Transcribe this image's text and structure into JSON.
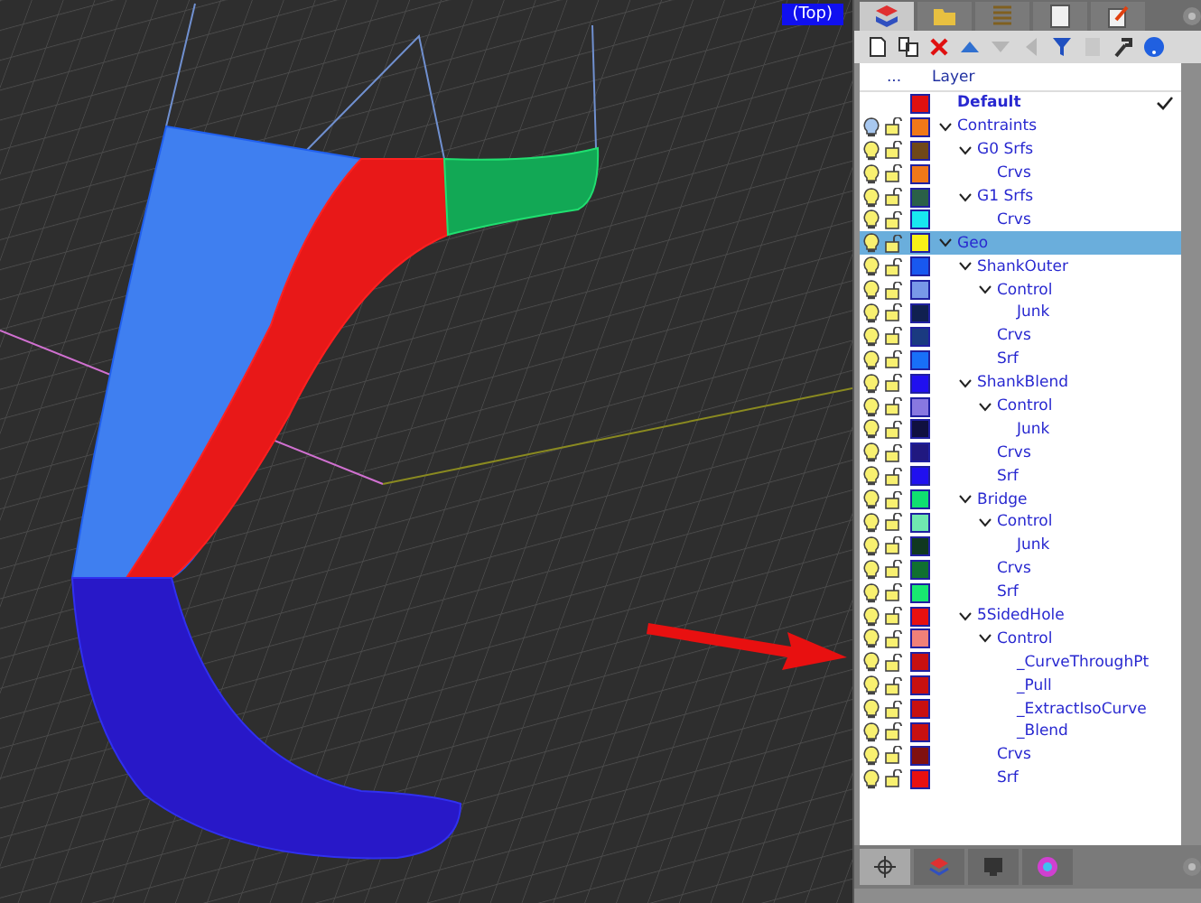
{
  "viewport": {
    "label": "(Top)"
  },
  "panel_tabs": [
    {
      "kind": "layers",
      "selected": true
    },
    {
      "kind": "folder",
      "selected": false
    },
    {
      "kind": "list",
      "selected": false
    },
    {
      "kind": "notes",
      "selected": false
    },
    {
      "kind": "edit",
      "selected": false
    }
  ],
  "toolbar": [
    {
      "kind": "new",
      "disabled": false
    },
    {
      "kind": "copy",
      "disabled": false
    },
    {
      "kind": "delete",
      "disabled": false
    },
    {
      "kind": "up",
      "disabled": false
    },
    {
      "kind": "down",
      "disabled": true
    },
    {
      "kind": "left",
      "disabled": true
    },
    {
      "kind": "filter",
      "disabled": false
    },
    {
      "kind": "page",
      "disabled": true
    },
    {
      "kind": "tools",
      "disabled": false
    },
    {
      "kind": "help",
      "disabled": false
    }
  ],
  "table": {
    "columns": [
      "...",
      "Layer"
    ],
    "layers": [
      {
        "name": "Default",
        "color": "#e01010",
        "current": true,
        "selected": false
      },
      {
        "name": "Contraints",
        "color": "#f07818",
        "current": false,
        "selected": false,
        "expanded": true,
        "children": [
          {
            "name": "G0 Srfs",
            "color": "#704818",
            "current": false,
            "selected": false,
            "expanded": true,
            "children": [
              {
                "name": "Crvs",
                "color": "#f07818",
                "current": false,
                "selected": false
              }
            ]
          },
          {
            "name": "G1 Srfs",
            "color": "#2a6048",
            "current": false,
            "selected": false,
            "expanded": true,
            "children": [
              {
                "name": "Crvs",
                "color": "#18e8f0",
                "current": false,
                "selected": false
              }
            ]
          }
        ]
      },
      {
        "name": "Geo",
        "color": "#f8f018",
        "current": false,
        "selected": true,
        "expanded": true,
        "children": [
          {
            "name": "ShankOuter",
            "color": "#1858f0",
            "current": false,
            "selected": false,
            "expanded": true,
            "children": [
              {
                "name": "Control",
                "color": "#7898e8",
                "current": false,
                "selected": false,
                "expanded": true,
                "children": [
                  {
                    "name": "Junk",
                    "color": "#102050",
                    "current": false,
                    "selected": false
                  }
                ]
              },
              {
                "name": "Crvs",
                "color": "#1a3a80",
                "current": false,
                "selected": false
              },
              {
                "name": "Srf",
                "color": "#1870f8",
                "current": false,
                "selected": false
              }
            ]
          },
          {
            "name": "ShankBlend",
            "color": "#2010f0",
            "current": false,
            "selected": false,
            "expanded": true,
            "children": [
              {
                "name": "Control",
                "color": "#8878e0",
                "current": false,
                "selected": false,
                "expanded": true,
                "children": [
                  {
                    "name": "Junk",
                    "color": "#101040",
                    "current": false,
                    "selected": false
                  }
                ]
              },
              {
                "name": "Crvs",
                "color": "#201880",
                "current": false,
                "selected": false
              },
              {
                "name": "Srf",
                "color": "#2010f0",
                "current": false,
                "selected": false
              }
            ]
          },
          {
            "name": "Bridge",
            "color": "#10e070",
            "current": false,
            "selected": false,
            "expanded": true,
            "children": [
              {
                "name": "Control",
                "color": "#70e8b0",
                "current": false,
                "selected": false,
                "expanded": true,
                "children": [
                  {
                    "name": "Junk",
                    "color": "#103820",
                    "current": false,
                    "selected": false
                  }
                ]
              },
              {
                "name": "Crvs",
                "color": "#107030",
                "current": false,
                "selected": false
              },
              {
                "name": "Srf",
                "color": "#18e870",
                "current": false,
                "selected": false
              }
            ]
          },
          {
            "name": "5SidedHole",
            "color": "#e81010",
            "current": false,
            "selected": false,
            "expanded": true,
            "children": [
              {
                "name": "Control",
                "color": "#f08078",
                "current": false,
                "selected": false,
                "expanded": true,
                "children": [
                  {
                    "name": "_CurveThroughPt",
                    "color": "#c81010",
                    "current": false,
                    "selected": false
                  },
                  {
                    "name": "_Pull",
                    "color": "#c81010",
                    "current": false,
                    "selected": false
                  },
                  {
                    "name": "_ExtractIsoCurve",
                    "color": "#c81010",
                    "current": false,
                    "selected": false
                  },
                  {
                    "name": "_Blend",
                    "color": "#c81010",
                    "current": false,
                    "selected": false
                  }
                ]
              },
              {
                "name": "Crvs",
                "color": "#801010",
                "current": false,
                "selected": false
              },
              {
                "name": "Srf",
                "color": "#e81010",
                "current": false,
                "selected": false
              }
            ]
          }
        ]
      }
    ]
  },
  "bottom_tabs": [
    {
      "kind": "target",
      "selected": true
    },
    {
      "kind": "layers",
      "selected": false
    },
    {
      "kind": "display",
      "selected": false
    },
    {
      "kind": "color",
      "selected": false
    }
  ]
}
